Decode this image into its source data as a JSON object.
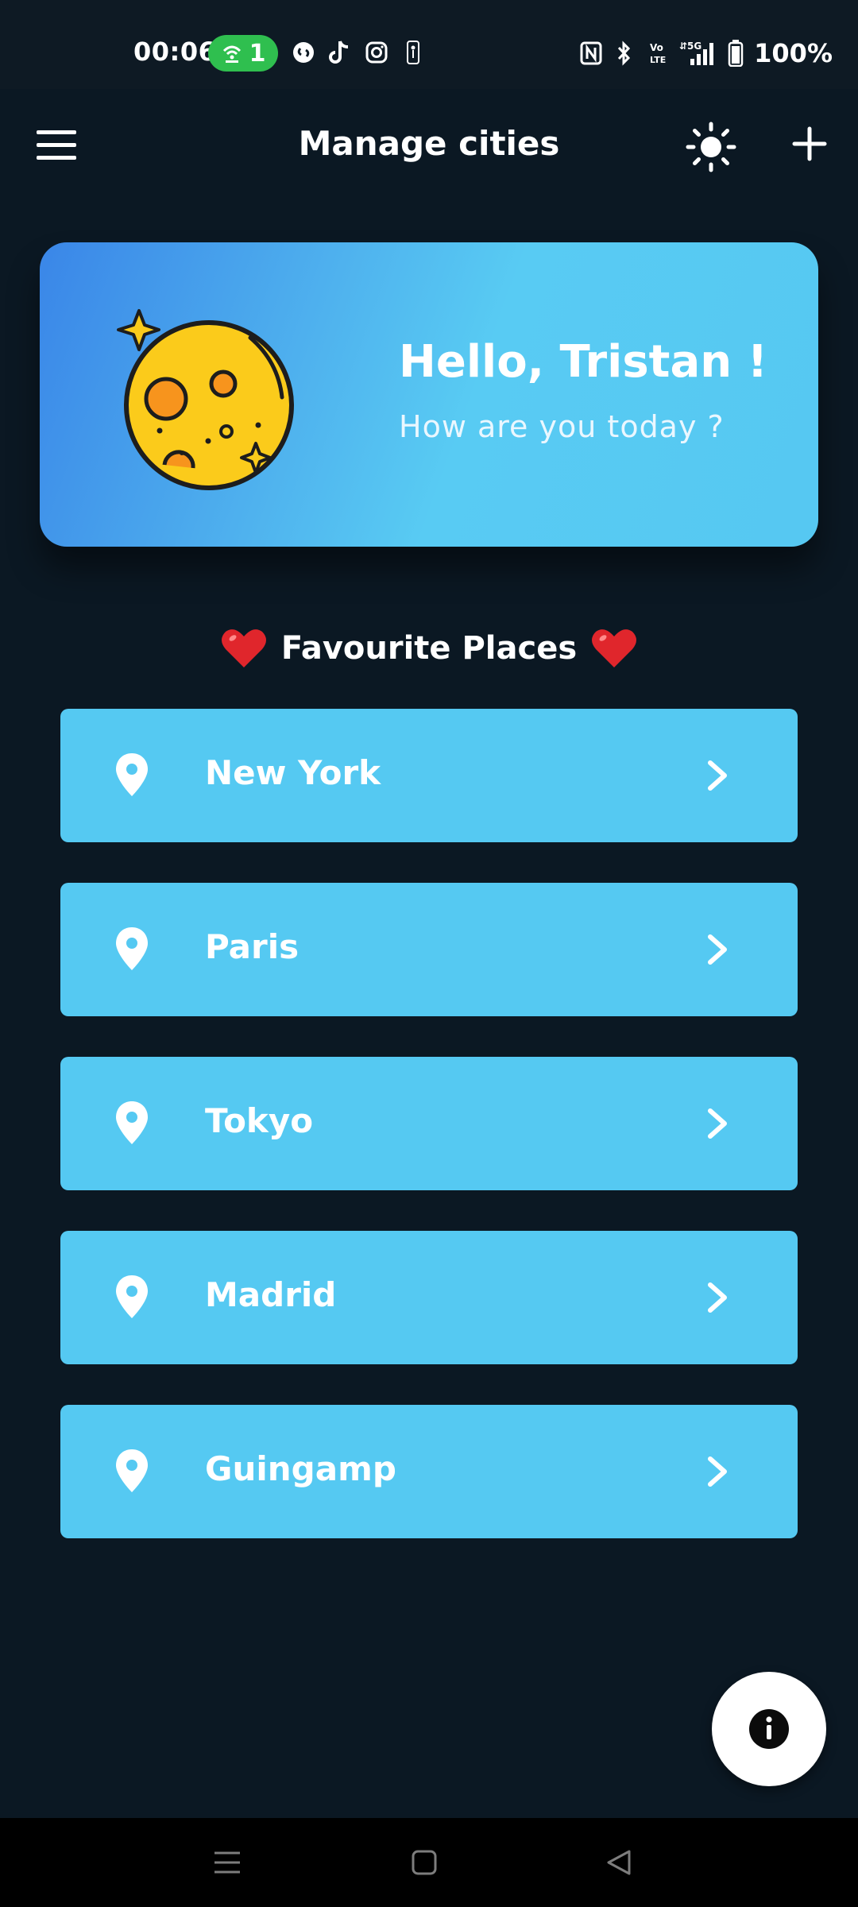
{
  "status_bar": {
    "time": "00:06",
    "hotspot_count": "1",
    "battery": "100%",
    "icons": [
      "wifi-hotspot-icon",
      "shazam-icon",
      "tiktok-icon",
      "instagram-icon",
      "nba-icon",
      "nfc-icon",
      "bluetooth-icon",
      "volte-icon",
      "5g-signal-icon",
      "battery-icon"
    ]
  },
  "app_bar": {
    "title": "Manage cities",
    "menu_icon": "hamburger-menu-icon",
    "theme_icon": "sun-icon",
    "add_icon": "plus-icon"
  },
  "greeting": {
    "title": "Hello, Tristan !",
    "subtitle": "How are you today ?",
    "illustration": "moon-icon"
  },
  "favourites": {
    "title": "Favourite Places",
    "cities": [
      {
        "name": "New York"
      },
      {
        "name": "Paris"
      },
      {
        "name": "Tokyo"
      },
      {
        "name": "Madrid"
      },
      {
        "name": "Guingamp"
      }
    ]
  },
  "colors": {
    "background": "#0b1823",
    "card_tile": "#55c9f2",
    "gradient_start": "#3a86e8",
    "gradient_end": "#56c8f2",
    "accent_green": "#2fbf4f"
  },
  "fab": {
    "icon": "info-icon"
  },
  "nav_bar": {
    "icons": [
      "recent-apps-icon",
      "home-icon",
      "back-icon"
    ]
  }
}
